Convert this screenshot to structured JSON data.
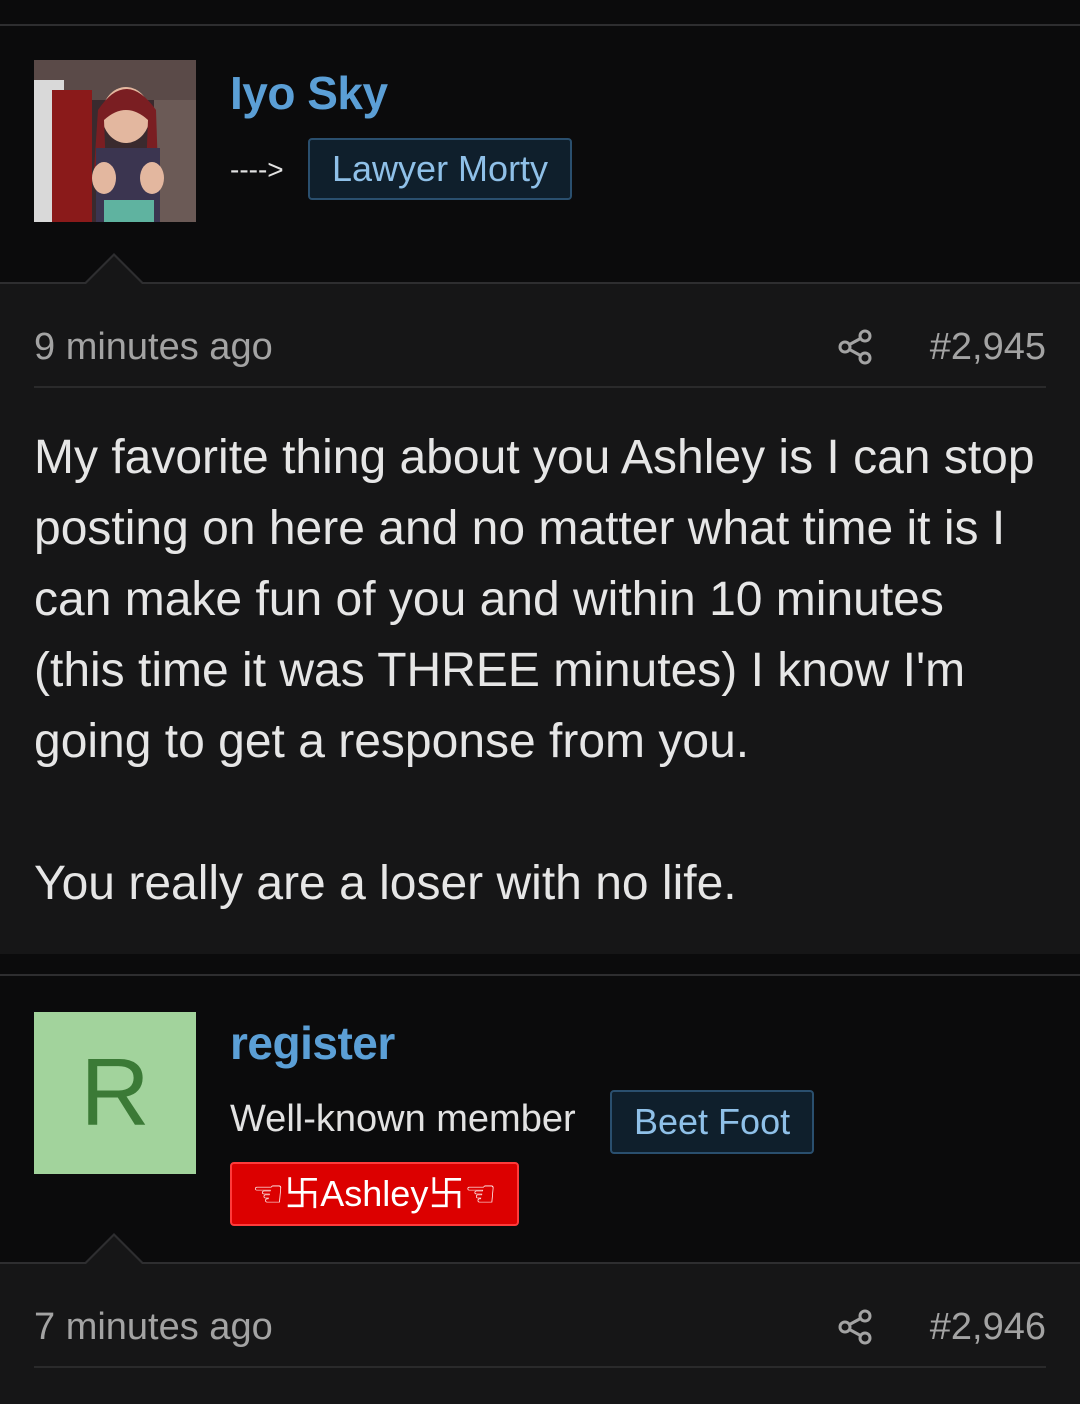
{
  "posts": [
    {
      "username": "Iyo Sky",
      "arrow": "---->",
      "banner": "Lawyer Morty",
      "time": "9 minutes ago",
      "number": "#2,945",
      "paragraphs": [
        "My favorite thing about you Ashley is I can stop posting on here and no matter what time it is I can make fun of you and within 10 minutes (this time it was THREE minutes) I know I'm going to get a response from you.",
        "You really are a loser with no life."
      ]
    },
    {
      "username": "register",
      "avatar_letter": "R",
      "user_title": "Well-known member",
      "banner": "Beet Foot",
      "red_banner": "☜卐Ashley卐☜",
      "time": "7 minutes ago",
      "number": "#2,946"
    }
  ],
  "colors": {
    "username": "#5b9fd6",
    "avatar_bg": "#a2d39c",
    "avatar_letter": "#3b7a36",
    "red_banner": "#dc0000"
  },
  "icons": [
    "share-icon"
  ]
}
